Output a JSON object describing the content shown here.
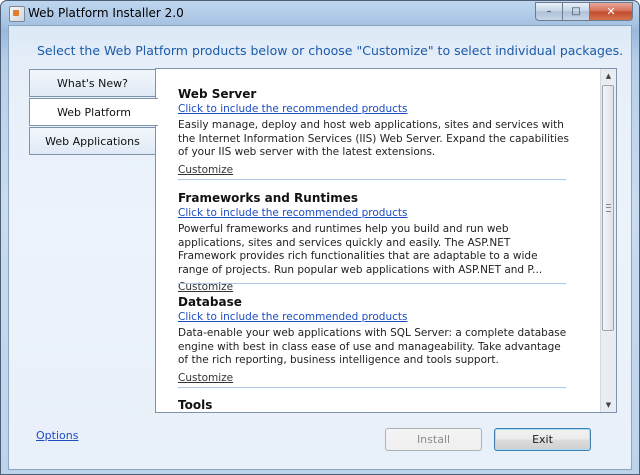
{
  "window": {
    "title": "Web Platform Installer 2.0",
    "controls": {
      "minimize": "–",
      "maximize": "□",
      "close": "✕"
    }
  },
  "instruction": "Select the Web Platform products below or choose \"Customize\" to select individual packages.",
  "tabs": [
    {
      "label": "What's New?",
      "selected": false
    },
    {
      "label": "Web Platform",
      "selected": true
    },
    {
      "label": "Web Applications",
      "selected": false
    }
  ],
  "sections": [
    {
      "title": "Web Server",
      "link": "Click to include the recommended products",
      "description": "Easily manage, deploy and host web applications, sites and services with the Internet Information Services (IIS) Web Server.  Expand the capabilities of your IIS web server with the latest extensions.",
      "customize": "Customize"
    },
    {
      "title": "Frameworks and Runtimes",
      "link": "Click to include the recommended products",
      "description": "Powerful frameworks and runtimes help you build and run web applications, sites and services quickly and easily.  The ASP.NET Framework provides rich functionalities that are adaptable to a wide range of projects. Run popular web applications with ASP.NET and P...",
      "customize": "Customize"
    },
    {
      "title": "Database",
      "link": "Click to include the recommended products",
      "description": "Data-enable your web applications with SQL Server: a complete database engine with best in class ease of use and manageability. Take advantage of the rich reporting, business intelligence and tools support.",
      "customize": "Customize"
    },
    {
      "title": "Tools"
    }
  ],
  "footer": {
    "options": "Options",
    "install": "Install",
    "exit": "Exit"
  },
  "colors": {
    "link": "#1d4cc1",
    "instruction": "#1d5aa8",
    "divider": "#a9c9e6"
  }
}
